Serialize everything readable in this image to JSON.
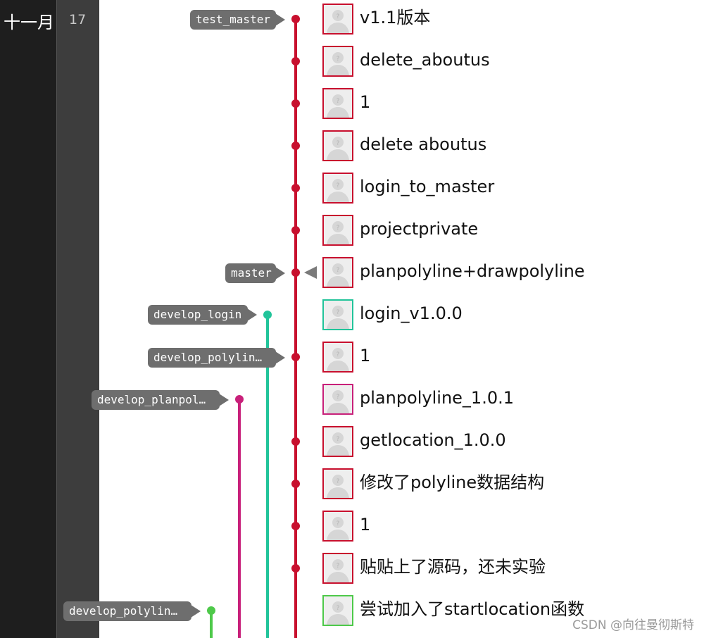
{
  "date": {
    "month": "十一月",
    "day": "17"
  },
  "colors": {
    "master": "#c8102e",
    "develop_login": "#22c49a",
    "develop_planpol": "#c8207a",
    "develop_polyline2": "#4ec94a",
    "tag_bg": "#6e6e6e"
  },
  "branch_tags": [
    {
      "label": "test_master"
    },
    {
      "label": "master"
    },
    {
      "label": "develop_login"
    },
    {
      "label": "develop_polylin…"
    },
    {
      "label": "develop_planpol…"
    },
    {
      "label": "develop_polylin…"
    }
  ],
  "commits": [
    {
      "message": "v1.1版本",
      "lane": "master",
      "avatar_color": "#c8102e"
    },
    {
      "message": "delete_aboutus",
      "lane": "master",
      "avatar_color": "#c8102e"
    },
    {
      "message": "1",
      "lane": "master",
      "avatar_color": "#c8102e"
    },
    {
      "message": "delete aboutus",
      "lane": "master",
      "avatar_color": "#c8102e"
    },
    {
      "message": "login_to_master",
      "lane": "master",
      "avatar_color": "#c8102e"
    },
    {
      "message": "projectprivate",
      "lane": "master",
      "avatar_color": "#c8102e"
    },
    {
      "message": "planpolyline+drawpolyline",
      "lane": "master",
      "avatar_color": "#c8102e"
    },
    {
      "message": "login_v1.0.0",
      "lane": "develop_login",
      "avatar_color": "#22c49a"
    },
    {
      "message": "1",
      "lane": "master",
      "avatar_color": "#c8102e"
    },
    {
      "message": "planpolyline_1.0.1",
      "lane": "develop_planpol",
      "avatar_color": "#c8207a"
    },
    {
      "message": "getlocation_1.0.0",
      "lane": "master",
      "avatar_color": "#c8102e"
    },
    {
      "message": "修改了polyline数据结构",
      "lane": "master",
      "avatar_color": "#c8102e"
    },
    {
      "message": "1",
      "lane": "master",
      "avatar_color": "#c8102e"
    },
    {
      "message": "贴贴上了源码，还未实验",
      "lane": "master",
      "avatar_color": "#c8102e"
    },
    {
      "message": "尝试加入了startlocation函数",
      "lane": "develop_polyline2",
      "avatar_color": "#4ec94a"
    }
  ],
  "watermark": "CSDN @向往曼彻斯特"
}
